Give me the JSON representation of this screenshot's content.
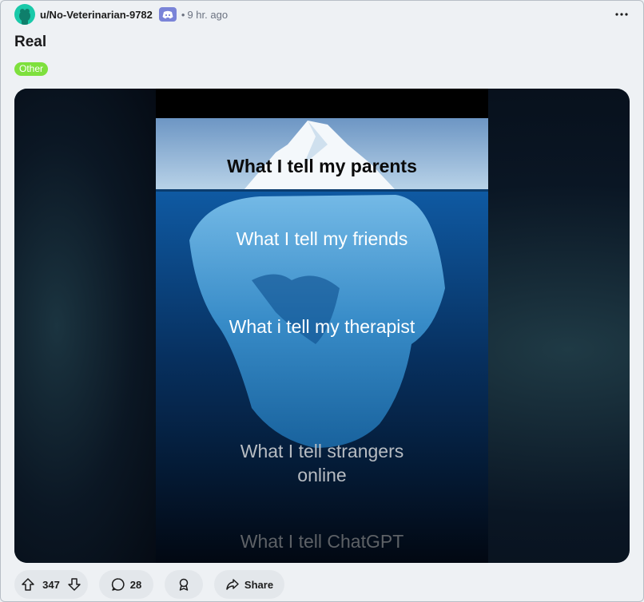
{
  "post": {
    "username": "u/No-Veterinarian-9782",
    "separator": "•",
    "time_ago": "9 hr. ago",
    "title": "Real",
    "flair": "Other"
  },
  "media": {
    "captions": [
      "What I tell my parents",
      "What I tell my friends",
      "What i tell my therapist",
      "What I tell strangers\nonline",
      "What I tell ChatGPT"
    ]
  },
  "actions": {
    "votes": "347",
    "comments": "28",
    "share_label": "Share"
  },
  "icons": [
    "avatar",
    "discord-badge-icon",
    "more-options-icon",
    "upvote-icon",
    "downvote-icon",
    "comment-icon",
    "award-icon",
    "share-icon"
  ],
  "colors": {
    "flair_bg": "#7ee03d",
    "avatar_bg": "#19c9a9",
    "badge_bg": "#7a84d8",
    "page_bg": "#eef1f4"
  }
}
